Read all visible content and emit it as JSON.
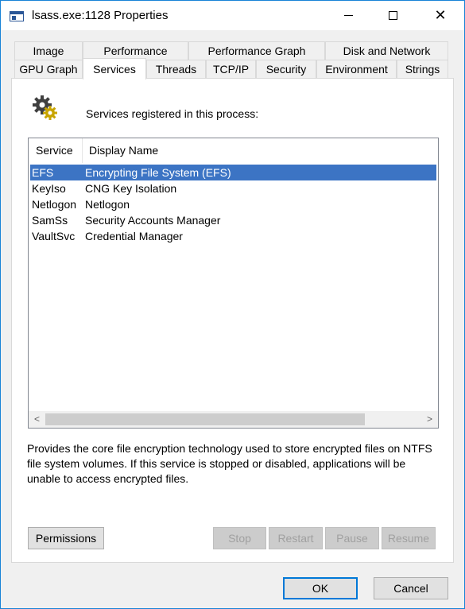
{
  "window": {
    "title": "lsass.exe:1128 Properties",
    "controls": {
      "minimize": "minimize",
      "maximize": "maximize",
      "close": "✕"
    }
  },
  "tabs": {
    "row1": [
      "Image",
      "Performance",
      "Performance Graph",
      "Disk and Network"
    ],
    "row2": [
      "GPU Graph",
      "Services",
      "Threads",
      "TCP/IP",
      "Security",
      "Environment",
      "Strings"
    ],
    "active": "Services"
  },
  "panel": {
    "icon": "services-gear-icon",
    "intro": "Services registered in this process:",
    "columns": [
      "Service",
      "Display Name"
    ],
    "rows": [
      {
        "service": "EFS",
        "display": "Encrypting File System (EFS)",
        "selected": true
      },
      {
        "service": "KeyIso",
        "display": "CNG Key Isolation",
        "selected": false
      },
      {
        "service": "Netlogon",
        "display": "Netlogon",
        "selected": false
      },
      {
        "service": "SamSs",
        "display": "Security Accounts Manager",
        "selected": false
      },
      {
        "service": "VaultSvc",
        "display": "Credential Manager",
        "selected": false
      }
    ],
    "scroll": {
      "left": "<",
      "right": ">"
    },
    "description": "Provides the core file encryption technology used to store encrypted files on NTFS file system volumes. If this service is stopped or disabled, applications will be unable to access encrypted files.",
    "buttons": {
      "permissions": "Permissions",
      "stop": "Stop",
      "restart": "Restart",
      "pause": "Pause",
      "resume": "Resume"
    }
  },
  "footer": {
    "ok": "OK",
    "cancel": "Cancel"
  },
  "colors": {
    "selection": "#3c74c4",
    "window_border": "#1883d7",
    "default_button_border": "#0078d7"
  }
}
